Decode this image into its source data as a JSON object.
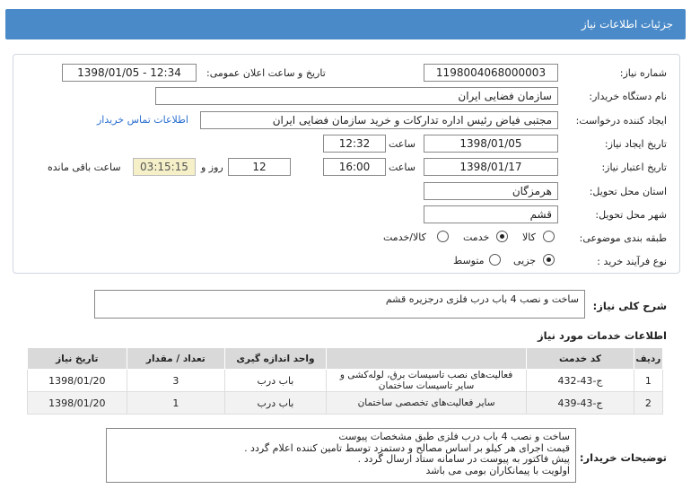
{
  "header": {
    "title": "جزئیات اطلاعات نیاز"
  },
  "form": {
    "need_number_label": "شماره نیاز:",
    "need_number": "1198004068000003",
    "announce_label": "تاریخ و ساعت اعلان عمومی:",
    "announce_value": "1398/01/05 - 12:34",
    "buyer_label": "نام دستگاه خریدار:",
    "buyer_value": "سازمان فضایی ایران",
    "creator_label": "ایجاد کننده درخواست:",
    "creator_value": "مجتبی  فیاض رئیس اداره تدارکات و خرید سازمان فضایی ایران",
    "contact_link": "اطلاعات تماس خریدار",
    "created_date_label": "تاریخ ایجاد نیاز:",
    "created_date": "1398/01/05",
    "time_label": "ساعت",
    "created_time": "12:32",
    "validity_label": "تاریخ اعتبار نیاز:",
    "validity_date": "1398/01/17",
    "validity_time": "16:00",
    "days_value": "12",
    "days_label": "روز و",
    "remaining_time": "03:15:15",
    "remaining_label": "ساعت باقی مانده",
    "province_label": "استان محل تحویل:",
    "province_value": "هرمزگان",
    "city_label": "شهر محل تحویل:",
    "city_value": "قشم",
    "category_label": "طبقه بندی موضوعی:",
    "category_options": [
      "کالا",
      "خدمت",
      "کالا/خدمت"
    ],
    "purchase_label": "نوع فرآیند خرید :",
    "purchase_options": [
      "جزیی",
      "متوسط"
    ]
  },
  "summary": {
    "label": "شرح کلی نیاز:",
    "value": "ساخت و نصب 4 باب درب فلزی درجزیره قشم"
  },
  "services": {
    "title": "اطلاعات خدمات مورد نیاز",
    "headers": [
      "ردیف",
      "کد خدمت",
      "واحد اندازه گیری",
      "تعداد / مقدار",
      "تاریخ نیاز"
    ],
    "rows": [
      {
        "index": "1",
        "code": "ج-43-432",
        "name": "فعالیت‌های نصب تاسیسات برق، لوله‌کشی و سایر تاسیسات ساختمان",
        "unit": "باب درب",
        "qty": "3",
        "date": "1398/01/20"
      },
      {
        "index": "2",
        "code": "ج-43-439",
        "name": "سایر فعالیت‌های تخصصی ساختمان",
        "unit": "باب درب",
        "qty": "1",
        "date": "1398/01/20"
      }
    ]
  },
  "buyer_notes": {
    "label": "توضیحات خریدار:",
    "lines": [
      "ساخت و نصب 4 باب درب فلزی طبق مشخصات پیوست",
      "قیمت اجرای هر کیلو بر اساس مصالح و دستمزد توسط تامین کننده اعلام گردد .",
      "پیش فاکتور به پیوست در سامانه ستاد ارسال گردد .",
      "اولویت با پیمانکاران بومی می باشد"
    ]
  }
}
